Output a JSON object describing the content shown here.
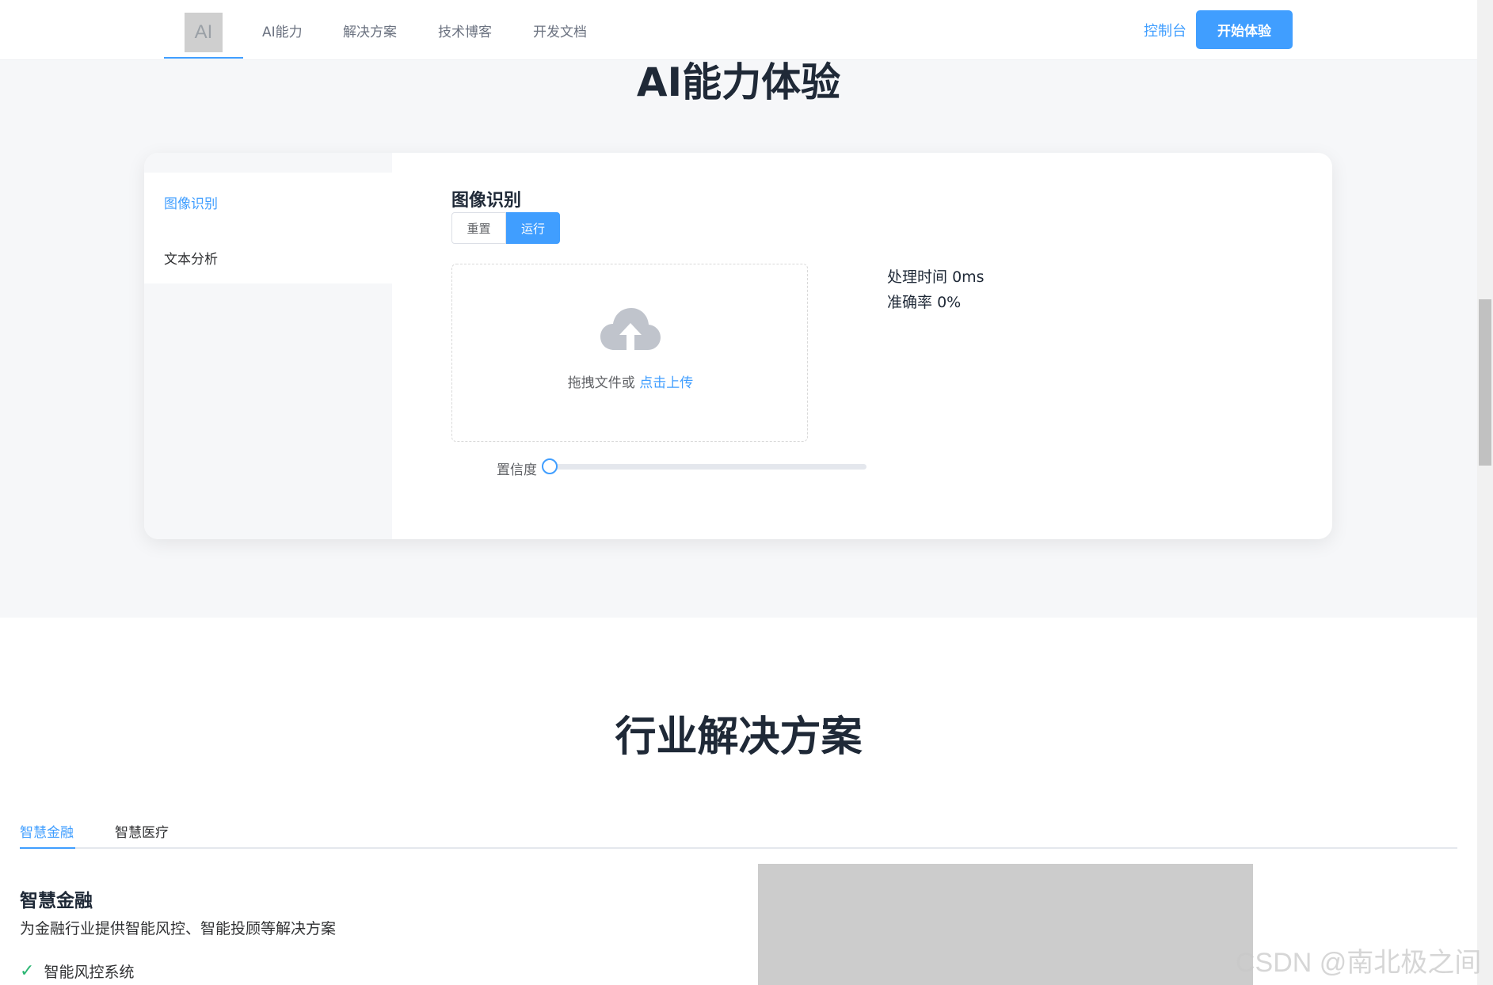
{
  "header": {
    "logo_text": "AI",
    "nav": [
      {
        "label": "AI能力"
      },
      {
        "label": "解决方案"
      },
      {
        "label": "技术博客"
      },
      {
        "label": "开发文档"
      }
    ],
    "console_label": "控制台",
    "start_label": "开始体验"
  },
  "ai_section": {
    "title": "AI能力体验",
    "sidebar": [
      {
        "label": "图像识别",
        "active": true
      },
      {
        "label": "文本分析",
        "active": false
      }
    ],
    "panel_title": "图像识别",
    "reset_label": "重置",
    "run_label": "运行",
    "upload": {
      "icon": "cloud-upload-icon",
      "prompt": "拖拽文件或",
      "link": "点击上传"
    },
    "stats": {
      "time_label": "处理时间",
      "time_value": "0ms",
      "accuracy_label": "准确率",
      "accuracy_value": "0%"
    },
    "confidence": {
      "label": "置信度",
      "value_percent": 0
    }
  },
  "industry": {
    "title": "行业解决方案",
    "tabs": [
      {
        "label": "智慧金融",
        "active": true
      },
      {
        "label": "智慧医疗",
        "active": false
      }
    ],
    "solution_title": "智慧金融",
    "solution_desc": "为金融行业提供智能风控、智能投顾等解决方案",
    "features": [
      {
        "label": "智能风控系统",
        "icon": "check-icon"
      }
    ]
  },
  "watermark": "CSDN @南北极之间",
  "colors": {
    "accent": "#409eff",
    "section_bg": "#f6f7f9",
    "check": "#2bb673"
  }
}
